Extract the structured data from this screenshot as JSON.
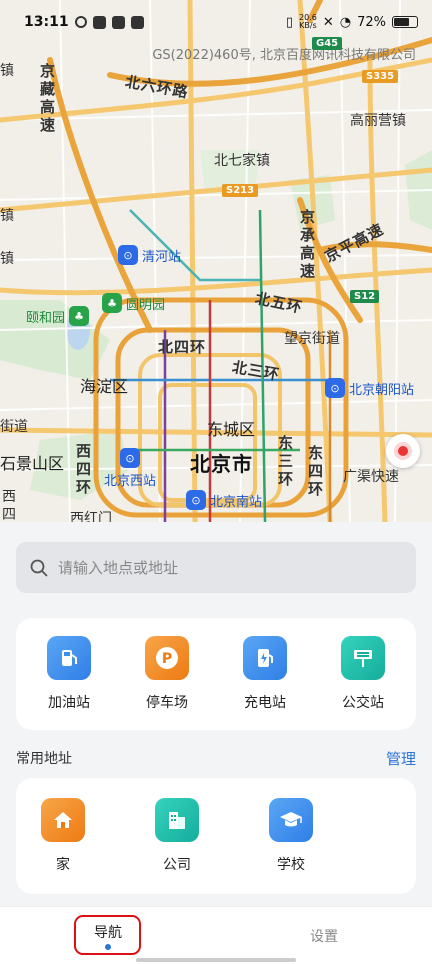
{
  "status_bar": {
    "time": "13:11",
    "net_speed_value": "20.6",
    "net_speed_unit": "KB/s",
    "battery_text": "72%",
    "battery_level": 0.72
  },
  "map": {
    "copyright": "GS(2022)460号, 北京百度网讯科技有限公司",
    "shields": {
      "g45": "G45",
      "s335": "S335",
      "s213": "S213",
      "s12": "S12"
    },
    "labels": {
      "zhen_left": "镇",
      "jingzang": "京藏高速",
      "beiliuhuan": "北六环路",
      "gaoliying": "高丽营镇",
      "beiqijia": "北七家镇",
      "zhen_left2": "镇",
      "jingcheng": "京承高速",
      "jingping": "京平高速",
      "zhen_left3": "镇",
      "beiwuhuan": "北五环",
      "wangjing": "望京街道",
      "beisihuan": "北四环",
      "beisanhuan": "北三环",
      "haidian": "海淀区",
      "dongcheng": "东城区",
      "jiedao_left": "街道",
      "shijingshan": "石景山区",
      "xisihuan": "西四环",
      "beijingshi": "北京市",
      "dongsanhuan": "东三环",
      "dongsihuan": "东四环",
      "guangqu": "广渠快速",
      "xi_left": "西四",
      "xianan": "西红门"
    },
    "stations": {
      "qinghe": "清河站",
      "beijing_chaoyang": "北京朝阳站",
      "beijing_xi": "北京西站",
      "beijing_nan": "北京南站"
    },
    "parks": {
      "yiheyuan": "颐和园",
      "yuanmingyuan": "圆明园"
    }
  },
  "search": {
    "placeholder": "请输入地点或地址"
  },
  "poi_shortcuts": [
    {
      "label": "加油站",
      "icon": "gas-station-icon",
      "color": "#3d8fee"
    },
    {
      "label": "停车场",
      "icon": "parking-icon",
      "color": "#f28a1e"
    },
    {
      "label": "充电站",
      "icon": "charging-icon",
      "color": "#3d8fee"
    },
    {
      "label": "公交站",
      "icon": "bus-stop-icon",
      "color": "#1fbfae"
    }
  ],
  "common_addresses": {
    "title": "常用地址",
    "manage_label": "管理",
    "items": [
      {
        "label": "家",
        "icon": "home-icon",
        "color": "#f28a1e"
      },
      {
        "label": "公司",
        "icon": "office-building-icon",
        "color": "#1fbfae"
      },
      {
        "label": "学校",
        "icon": "graduation-cap-icon",
        "color": "#3d8fee"
      }
    ]
  },
  "bottom_nav": {
    "tabs": [
      {
        "label": "导航",
        "active": true
      },
      {
        "label": "设置",
        "active": false
      }
    ]
  },
  "colors": {
    "accent": "#2b74d8",
    "highlight_border": "#d11111"
  }
}
